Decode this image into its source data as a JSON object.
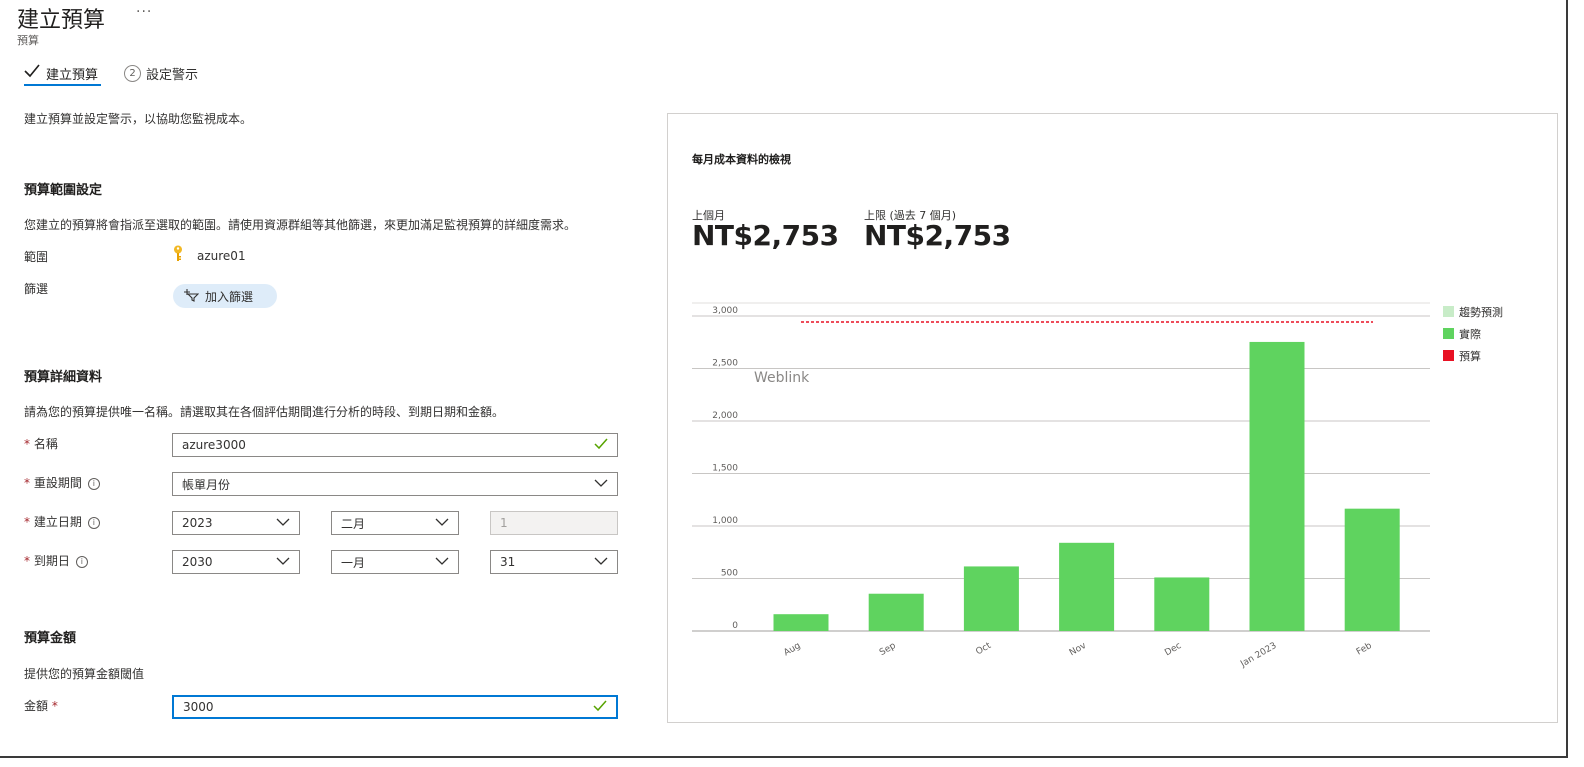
{
  "header": {
    "title": "建立預算",
    "more": "···",
    "subtitle": "預算"
  },
  "tabs": [
    {
      "label": "建立預算",
      "active": true
    },
    {
      "step": "2",
      "label": "設定警示",
      "active": false
    }
  ],
  "intro": "建立預算並設定警示，以協助您監視成本。",
  "scope_section": {
    "heading": "預算範圍設定",
    "description": "您建立的預算將會指派至選取的範圍。請使用資源群組等其他篩選，來更加滿足監視預算的詳細度需求。",
    "scope_label": "範圍",
    "scope_value": "azure01",
    "filter_label": "篩選",
    "add_filter": "加入篩選"
  },
  "details_section": {
    "heading": "預算詳細資料",
    "description": "請為您的預算提供唯一名稱。請選取其在各個評估期間進行分析的時段、到期日期和金額。",
    "name_label": "名稱",
    "name_value": "azure3000",
    "reset_label": "重設期間",
    "reset_value": "帳單月份",
    "create_label": "建立日期",
    "create_year": "2023",
    "create_month": "二月",
    "create_day": "1",
    "expire_label": "到期日",
    "expire_year": "2030",
    "expire_month": "一月",
    "expire_day": "31"
  },
  "amount_section": {
    "heading": "預算金額",
    "description": "提供您的預算金額閾值",
    "amount_label": "金額",
    "amount_value": "3000"
  },
  "panel": {
    "title": "每月成本資料的檢視",
    "last_month_label": "上個月",
    "last_month_value": "NT$2,753",
    "upper_label": "上限 (過去 7 個月)",
    "upper_value": "NT$2,753",
    "watermark": "Weblink"
  },
  "colors": {
    "accent": "#0078d4",
    "actual": "#5fd35f",
    "forecast": "#c8ecc8",
    "budget": "#e81123",
    "success": "#57a300"
  },
  "chart_data": {
    "type": "bar",
    "categories": [
      "Aug",
      "Sep",
      "Oct",
      "Nov",
      "Dec",
      "Jan 2023",
      "Feb"
    ],
    "series": [
      {
        "name": "實際",
        "values": [
          160,
          355,
          615,
          840,
          510,
          2753,
          1165
        ]
      }
    ],
    "budget_line": 3000,
    "ylim": [
      0,
      3000
    ],
    "y_ticks": [
      0,
      500,
      1000,
      1500,
      2000,
      2500,
      3000
    ],
    "y_tick_labels": [
      "0",
      "500",
      "1,000",
      "1,500",
      "2,000",
      "2,500",
      "3,000"
    ],
    "legend": [
      {
        "name": "趨勢預測",
        "color": "#c8ecc8"
      },
      {
        "name": "實際",
        "color": "#5fd35f"
      },
      {
        "name": "預算",
        "color": "#e81123"
      }
    ],
    "legend_position": "right",
    "grid": true
  }
}
